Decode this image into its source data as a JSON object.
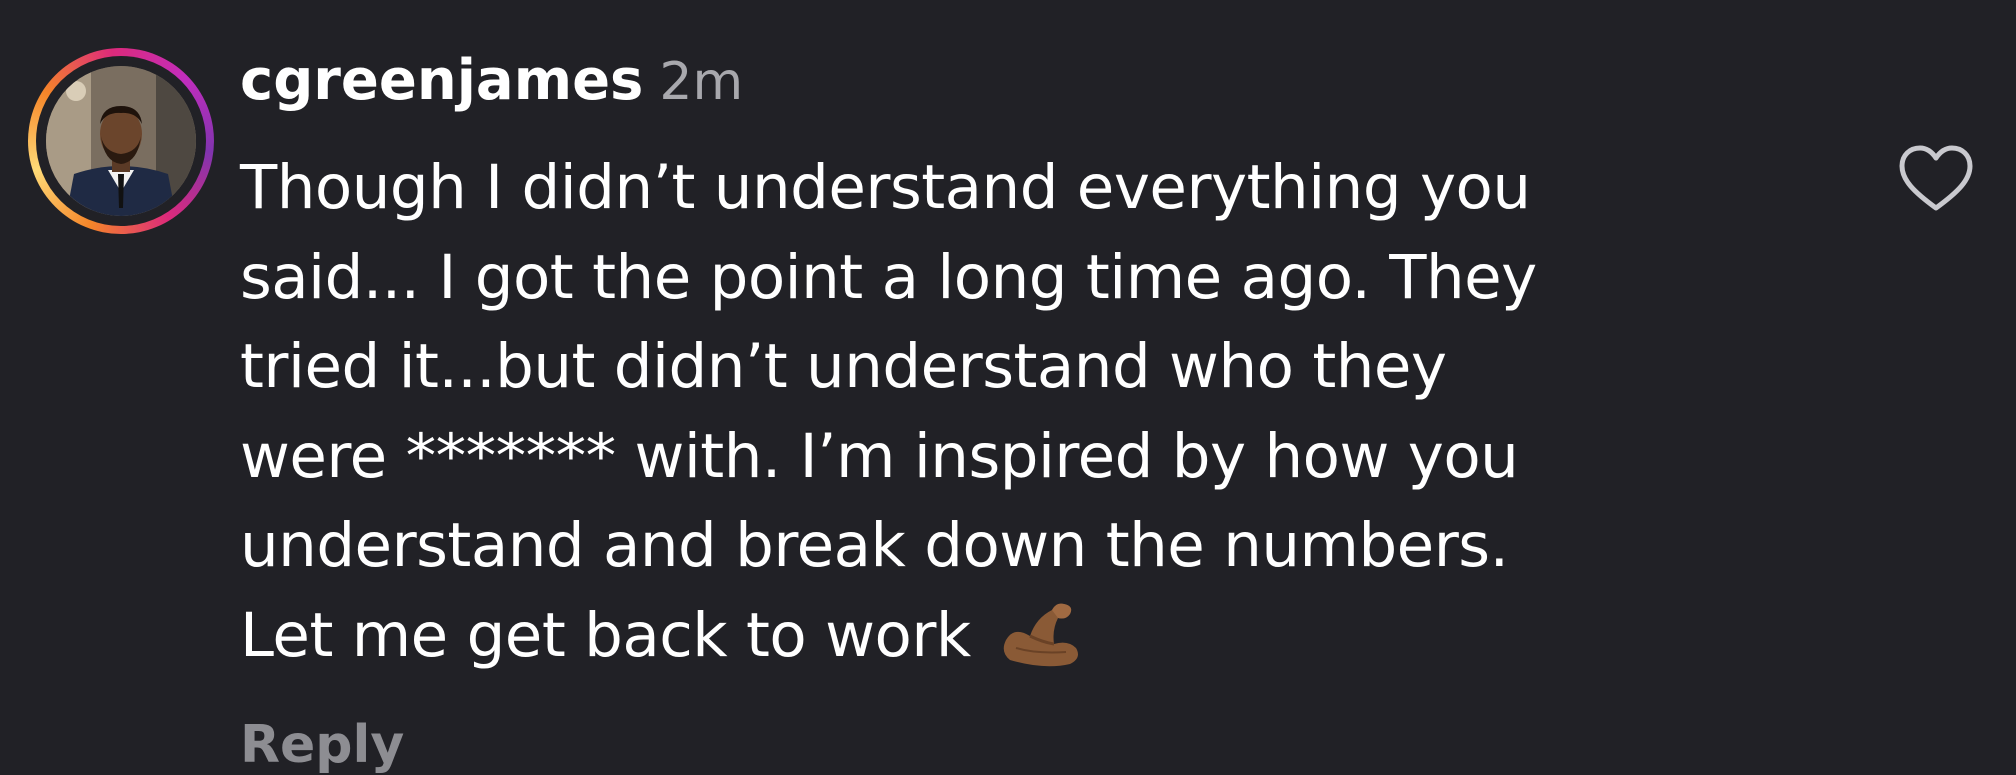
{
  "comment": {
    "username": "cgreenjames",
    "timestamp": "2m",
    "lines": [
      "Though I didn’t understand everything you",
      "said... I got the point a long time ago.  They",
      "tried it...but didn’t understand who they",
      "were ******* with.  I’m inspired by how you",
      "understand and break down the numbers.",
      "Let me get back to work"
    ],
    "emoji": "flexed-biceps-medium-dark-skin",
    "reply_label": "Reply",
    "like_icon": "heart-outline-icon"
  },
  "colors": {
    "background": "#212126",
    "text": "#ffffff",
    "muted": "#a8a8ad",
    "reply": "#8d8d92"
  }
}
